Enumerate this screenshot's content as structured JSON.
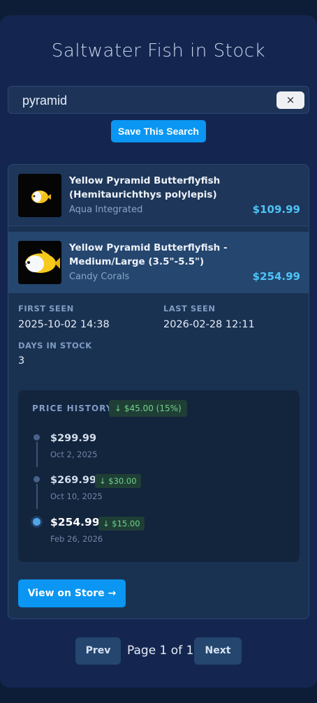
{
  "title": "Saltwater Fish in Stock",
  "search": {
    "value": "pyramid",
    "clear_label": "×"
  },
  "save_search_label": "Save This Search",
  "items": [
    {
      "name": "Yellow Pyramid Butterflyfish (Hemitaurichthys polylepis)",
      "store": "Aqua Integrated",
      "price": "$109.99"
    },
    {
      "name": "Yellow Pyramid Butterflyfish - Medium/Large (3.5\"-5.5\")",
      "store": "Candy Corals",
      "price": "$254.99",
      "details": {
        "first_seen_label": "FIRST SEEN",
        "first_seen": "2025-10-02 14:38",
        "last_seen_label": "LAST SEEN",
        "last_seen": "2026-02-28 12:11",
        "days_label": "DAYS IN STOCK",
        "days": "3"
      },
      "price_history": {
        "title": "PRICE HISTORY",
        "total_drop": "↓ $45.00 (15%)",
        "entries": [
          {
            "price": "$299.99",
            "date": "Oct 2, 2025",
            "change": ""
          },
          {
            "price": "$269.99",
            "date": "Oct 10, 2025",
            "change": "↓ $30.00"
          },
          {
            "price": "$254.99",
            "date": "Feb 26, 2026",
            "change": "↓ $15.00"
          }
        ]
      },
      "view_label": "View on Store →"
    }
  ],
  "pagination": {
    "prev_label": "Prev",
    "info": "Page 1 of 1",
    "next_label": "Next"
  },
  "colors": {
    "background": "#0d1d38",
    "panel": "#142650",
    "accent": "#0a96f2",
    "price": "#4fc3f7",
    "drop": "#6fd38a"
  }
}
